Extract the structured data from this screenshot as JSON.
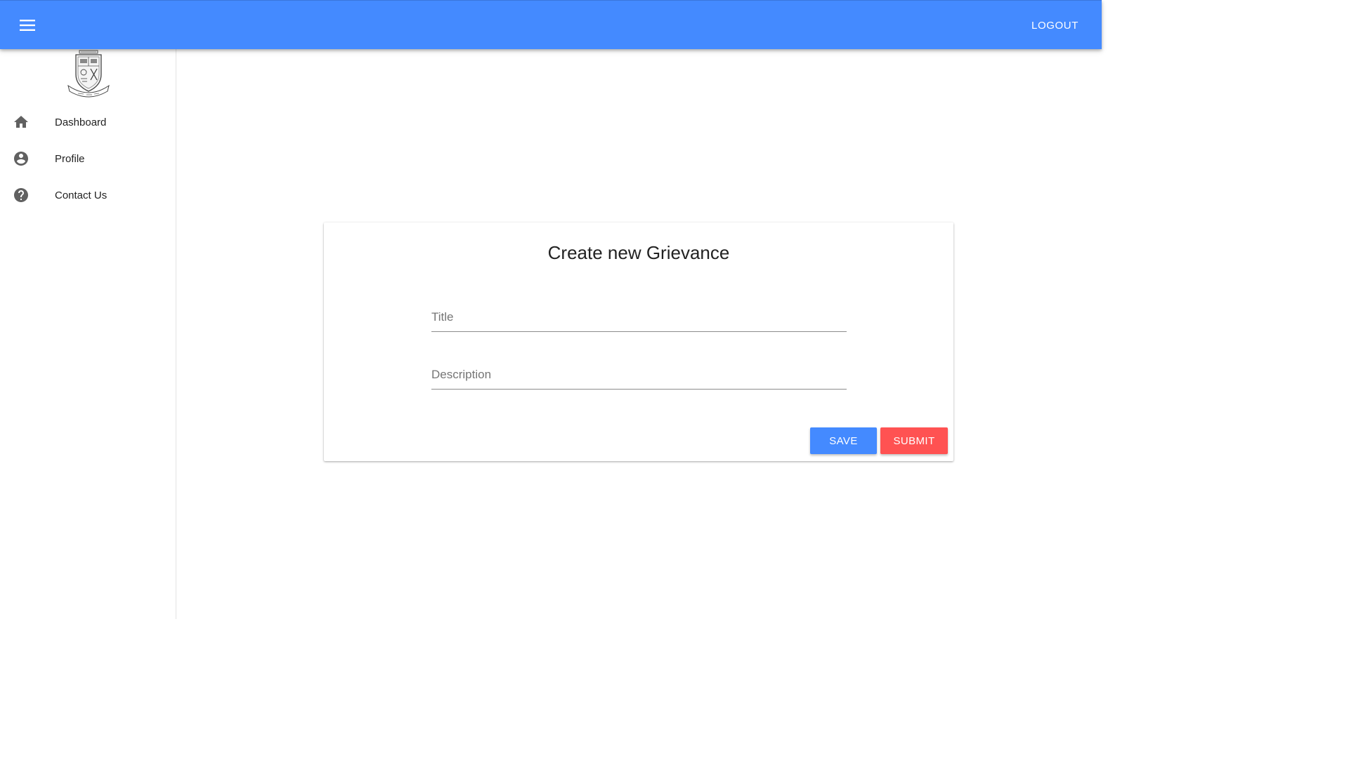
{
  "header": {
    "menu_icon": "menu-icon",
    "logout_label": "LOGOUT",
    "bar_color": "#448aff"
  },
  "sidebar": {
    "logo": "college-crest-logo",
    "items": [
      {
        "label": "Dashboard",
        "icon": "home-icon"
      },
      {
        "label": "Profile",
        "icon": "account-circle-icon"
      },
      {
        "label": "Contact Us",
        "icon": "help-circle-icon"
      }
    ]
  },
  "form": {
    "title": "Create new Grievance",
    "fields": {
      "title": {
        "placeholder": "Title",
        "value": ""
      },
      "description": {
        "placeholder": "Description",
        "value": ""
      }
    },
    "save_label": "SAVE",
    "submit_label": "SUBMIT",
    "save_color": "#448aff",
    "submit_color": "#ff5252"
  }
}
